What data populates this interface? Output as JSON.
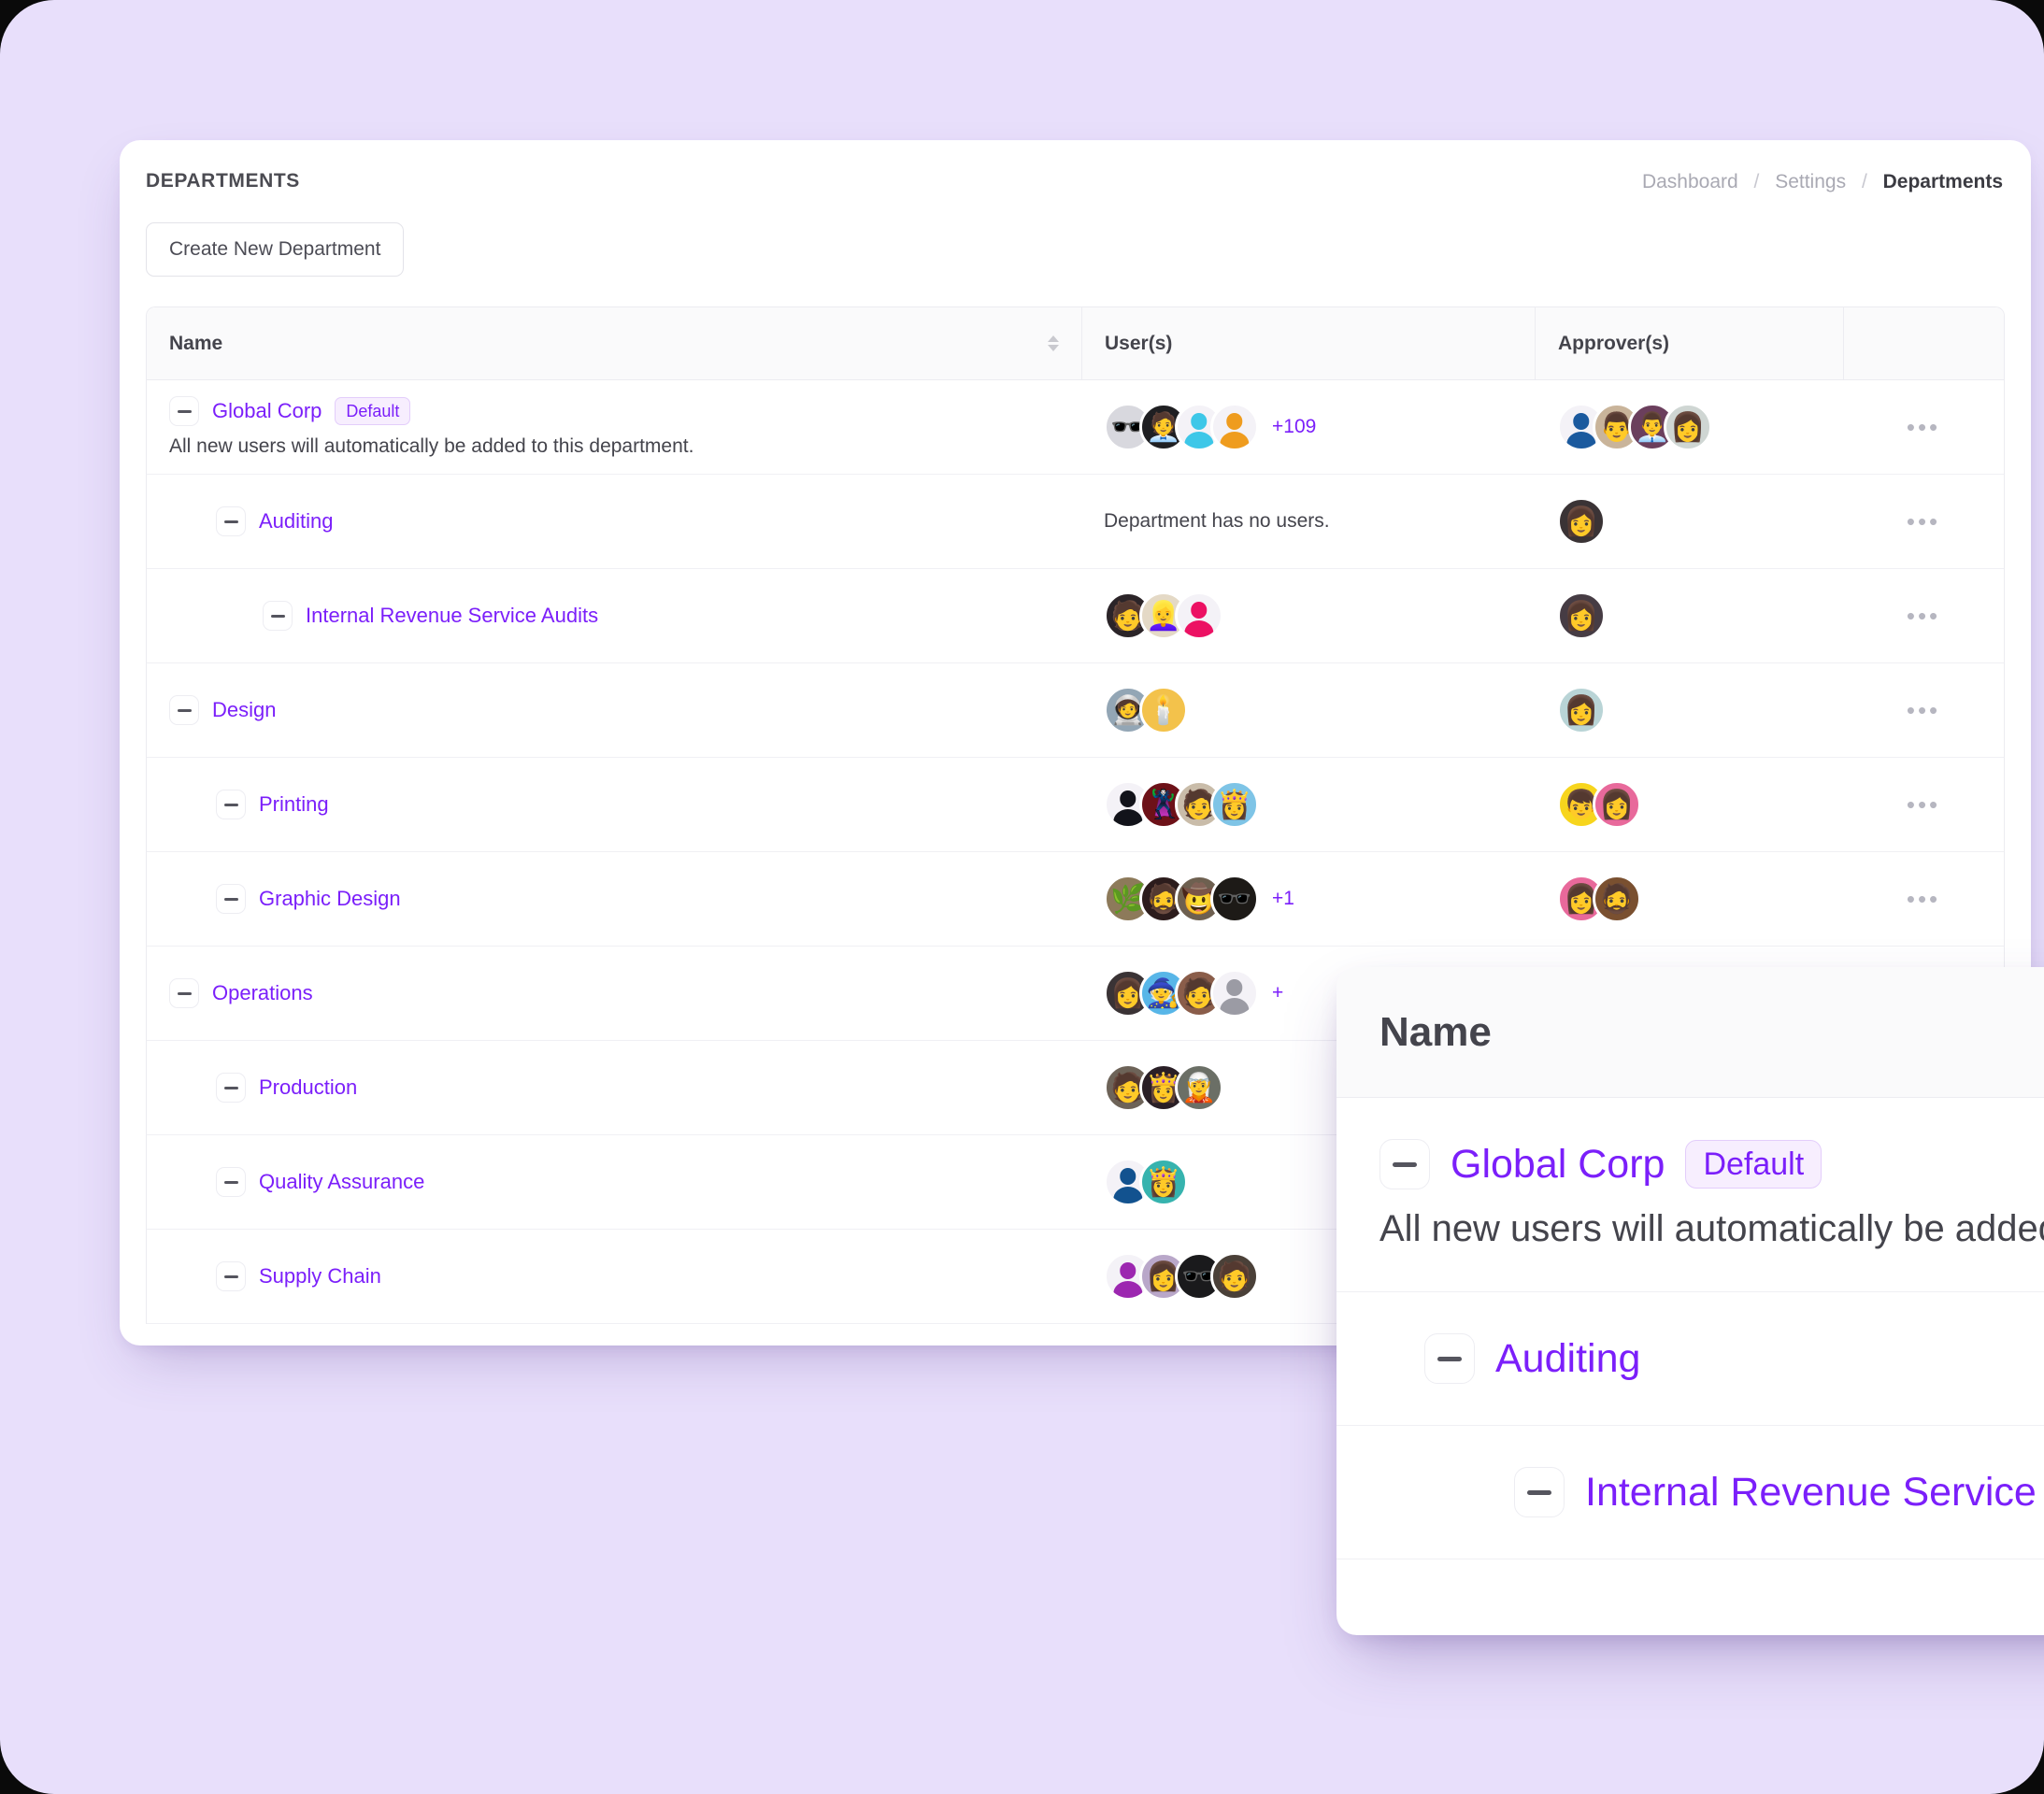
{
  "page": {
    "title": "DEPARTMENTS",
    "background_color": "#e8dffb",
    "accent_color": "#7b1ffa"
  },
  "breadcrumb": {
    "items": [
      "Dashboard",
      "Settings",
      "Departments"
    ],
    "separator": "/"
  },
  "toolbar": {
    "create_label": "Create New Department"
  },
  "table": {
    "headers": {
      "name": "Name",
      "users": "User(s)",
      "approvers": "Approver(s)",
      "actions": ""
    },
    "sort_icon": "sort-arrows-icon",
    "row_menu_glyph": "•••",
    "empty_users_text": "Department has no users.",
    "rows": [
      {
        "name": "Global Corp",
        "level": 1,
        "badge": "Default",
        "description": "All new users will automatically be added to this department.",
        "users": {
          "avatars": [
            "#d8d8de",
            "#1f1f22",
            "#3dc7e8",
            "#ef9c1e"
          ],
          "glyphs": [
            "🕶️",
            "🧑‍💼",
            "",
            ""
          ],
          "placeholders": [
            false,
            false,
            true,
            true
          ],
          "more": "+109"
        },
        "approvers": {
          "avatars": [
            "#1b5a9e",
            "#c9b49a",
            "#6b3f5d",
            "#cfd6d3"
          ],
          "glyphs": [
            "",
            "👨",
            "👨‍💼",
            "👩"
          ],
          "placeholders": [
            true,
            false,
            false,
            false
          ],
          "more": ""
        }
      },
      {
        "name": "Auditing",
        "level": 2,
        "badge": "",
        "description": "",
        "users": {
          "avatars": [],
          "glyphs": [],
          "placeholders": [],
          "more": "",
          "empty": true
        },
        "approvers": {
          "avatars": [
            "#3a3335"
          ],
          "glyphs": [
            "👩"
          ],
          "placeholders": [
            false
          ],
          "more": ""
        }
      },
      {
        "name": "Internal Revenue Service Audits",
        "level": 3,
        "badge": "",
        "description": "",
        "users": {
          "avatars": [
            "#2b2428",
            "#e4d9c6",
            "#ec1163"
          ],
          "glyphs": [
            "🧑",
            "👱‍♀️",
            ""
          ],
          "placeholders": [
            false,
            false,
            true
          ],
          "more": ""
        },
        "approvers": {
          "avatars": [
            "#463c44"
          ],
          "glyphs": [
            "👩"
          ],
          "placeholders": [
            false
          ],
          "more": ""
        }
      },
      {
        "name": "Design",
        "level": 1,
        "badge": "",
        "description": "",
        "users": {
          "avatars": [
            "#93a6b5",
            "#f3c24b"
          ],
          "glyphs": [
            "🧑‍🚀",
            "🕯️"
          ],
          "placeholders": [
            false,
            false
          ],
          "more": ""
        },
        "approvers": {
          "avatars": [
            "#b9d4d6"
          ],
          "glyphs": [
            "👩"
          ],
          "placeholders": [
            false
          ],
          "more": ""
        }
      },
      {
        "name": "Printing",
        "level": 2,
        "badge": "",
        "description": "",
        "users": {
          "avatars": [
            "#12131a",
            "#6d1118",
            "#c9bca9",
            "#7ec4e6"
          ],
          "glyphs": [
            "",
            "🦹",
            "🧑",
            "👸"
          ],
          "placeholders": [
            true,
            false,
            false,
            false
          ],
          "more": ""
        },
        "approvers": {
          "avatars": [
            "#f7d51d",
            "#e8699b"
          ],
          "glyphs": [
            "👦",
            "👩"
          ],
          "placeholders": [
            false,
            false
          ],
          "more": ""
        }
      },
      {
        "name": "Graphic Design",
        "level": 2,
        "badge": "",
        "description": "",
        "users": {
          "avatars": [
            "#8d7a5a",
            "#2c1c1c",
            "#6e6050",
            "#1d1a17"
          ],
          "glyphs": [
            "🌿",
            "🧔",
            "🤠",
            "🕶️"
          ],
          "placeholders": [
            false,
            false,
            false,
            false
          ],
          "more": "+1"
        },
        "approvers": {
          "avatars": [
            "#e8699b",
            "#7a5030"
          ],
          "glyphs": [
            "👩",
            "🧔"
          ],
          "placeholders": [
            false,
            false
          ],
          "more": ""
        }
      },
      {
        "name": "Operations",
        "level": 1,
        "badge": "",
        "description": "",
        "users": {
          "avatars": [
            "#3a3335",
            "#58b6e8",
            "#8a5d4a",
            "#9b9ba4"
          ],
          "glyphs": [
            "👩",
            "🧙",
            "🧑",
            ""
          ],
          "placeholders": [
            false,
            false,
            false,
            true
          ],
          "more": "+"
        },
        "approvers": {
          "avatars": [],
          "glyphs": [],
          "placeholders": [],
          "more": ""
        }
      },
      {
        "name": "Production",
        "level": 2,
        "badge": "",
        "description": "",
        "users": {
          "avatars": [
            "#6d6358",
            "#2a1f26",
            "#6b6f66"
          ],
          "glyphs": [
            "🧑",
            "👸",
            "🧝"
          ],
          "placeholders": [
            false,
            false,
            false
          ],
          "more": ""
        },
        "approvers": {
          "avatars": [],
          "glyphs": [],
          "placeholders": [],
          "more": ""
        }
      },
      {
        "name": "Quality Assurance",
        "level": 2,
        "badge": "",
        "description": "",
        "users": {
          "avatars": [
            "#12528f",
            "#36b3ae"
          ],
          "glyphs": [
            "",
            "👸"
          ],
          "placeholders": [
            true,
            false
          ],
          "more": ""
        },
        "approvers": {
          "avatars": [],
          "glyphs": [],
          "placeholders": [],
          "more": ""
        }
      },
      {
        "name": "Supply Chain",
        "level": 2,
        "badge": "",
        "description": "",
        "users": {
          "avatars": [
            "#9c27b0",
            "#b9a7c9",
            "#1a1a1c",
            "#4a4038"
          ],
          "glyphs": [
            "",
            "👩",
            "🕶️",
            "🧑"
          ],
          "placeholders": [
            true,
            false,
            false,
            false
          ],
          "more": ""
        },
        "approvers": {
          "avatars": [],
          "glyphs": [],
          "placeholders": [],
          "more": ""
        }
      }
    ]
  },
  "overlay": {
    "header": "Name",
    "rows": [
      {
        "name": "Global Corp",
        "badge": "Default",
        "description": "All new users will automatically be added t",
        "indent": 0
      },
      {
        "name": "Auditing",
        "badge": "",
        "description": "",
        "indent": 2
      },
      {
        "name": "Internal Revenue Service A",
        "badge": "",
        "description": "",
        "indent": 3
      }
    ]
  }
}
